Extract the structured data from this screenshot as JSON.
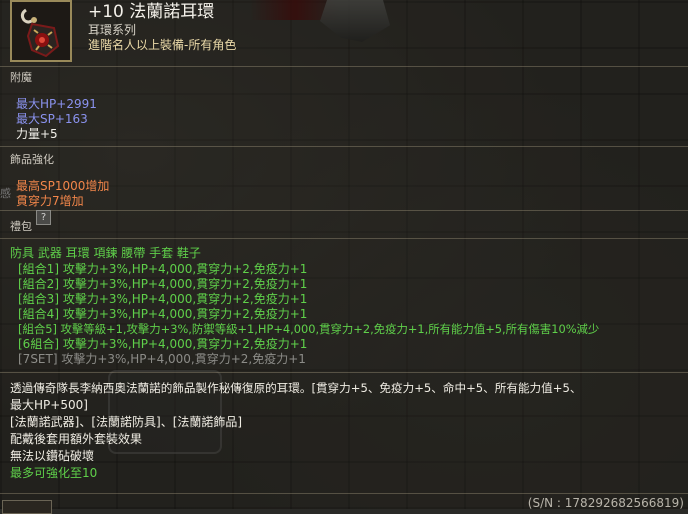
{
  "item": {
    "name": "+10 法蘭諾耳環",
    "category": "耳環系列",
    "requirement": "進階名人以上裝備-所有角色",
    "icon": "earring-icon"
  },
  "enchant": {
    "label": "附魔",
    "stats": [
      "最大HP+2991",
      "最大SP+163",
      "力量+5"
    ]
  },
  "accessory_enhance": {
    "label": "飾品強化",
    "stats": [
      "最高SP1000增加",
      "貫穿力7增加"
    ]
  },
  "side_text": "感",
  "gift": {
    "label": "禮包",
    "help_icon": "question-icon"
  },
  "set": {
    "slots": "防具 武器 耳環 項鍊 腰帶 手套 鞋子",
    "combos": [
      {
        "text": "[組合1] 攻擊力+3%,HP+4,000,貫穿力+2,免疫力+1",
        "state": "active"
      },
      {
        "text": "[組合2] 攻擊力+3%,HP+4,000,貫穿力+2,免疫力+1",
        "state": "active"
      },
      {
        "text": "[組合3] 攻擊力+3%,HP+4,000,貫穿力+2,免疫力+1",
        "state": "active"
      },
      {
        "text": "[組合4] 攻擊力+3%,HP+4,000,貫穿力+2,免疫力+1",
        "state": "active"
      },
      {
        "text": "[組合5] 攻擊等級+1,攻擊力+3%,防禦等級+1,HP+4,000,貫穿力+2,免疫力+1,所有能力值+5,所有傷害10%減少",
        "state": "active"
      },
      {
        "text": "[6組合] 攻擊力+3%,HP+4,000,貫穿力+2,免疫力+1",
        "state": "active"
      },
      {
        "text": "[7SET] 攻擊力+3%,HP+4,000,貫穿力+2,免疫力+1",
        "state": "inactive"
      }
    ]
  },
  "description": {
    "line1": "透過傳奇隊長李納西奧法蘭諾的飾品製作秘傳復原的耳環。[貫穿力+5、免疫力+5、命中+5、所有能力值+5、",
    "line2": "最大HP+500]",
    "line3": "[法蘭諾武器]、[法蘭諾防具]、[法蘭諾飾品]",
    "line4": "配戴後套用額外套裝效果",
    "line5": "無法以鑽砧破壞",
    "line6": "最多可強化至10"
  },
  "serial": "(S/N : 178292682566819)",
  "colors": {
    "stat_blue": "#8a92ee",
    "enhance_orange": "#f2864a",
    "set_green": "#5fd04a",
    "inactive_gray": "#8c8c88"
  }
}
